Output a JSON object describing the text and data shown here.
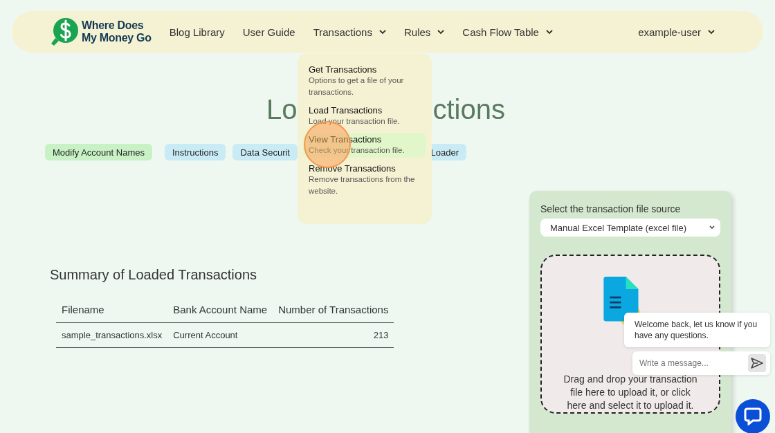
{
  "nav": {
    "logo": {
      "line1": "Where Does",
      "line2": "My Money Go"
    },
    "links": [
      {
        "label": "Blog Library",
        "has_caret": false
      },
      {
        "label": "User Guide",
        "has_caret": false
      },
      {
        "label": "Transactions",
        "has_caret": true
      },
      {
        "label": "Rules",
        "has_caret": true
      },
      {
        "label": "Cash Flow Table",
        "has_caret": true
      }
    ],
    "user": {
      "label": "example-user",
      "has_caret": true
    }
  },
  "menu": {
    "items": [
      {
        "title": "Get Transactions",
        "description": "Options to get a file of your transactions.",
        "selected": false
      },
      {
        "title": "Load Transactions",
        "description": "Load your transaction file.",
        "selected": false
      },
      {
        "title": "View Transactions",
        "description": "Check your transaction file.",
        "selected": true
      },
      {
        "title": "Remove Transactions",
        "description": "Remove transactions from the website.",
        "selected": false
      }
    ]
  },
  "page_title": {
    "left": "Lo",
    "right": "ctions"
  },
  "tabs": [
    {
      "label": "Modify Account Names",
      "color": "#c8f2c6"
    },
    {
      "label": "Instructions",
      "color": "#c9ebf5"
    },
    {
      "label": "Data Securit",
      "color": "#c9ebf5"
    },
    {
      "label": "Loader",
      "color": "#c9ebf5"
    }
  ],
  "summary": {
    "heading": "Summary of Loaded Transactions",
    "columns": [
      "Filename",
      "Bank Account Name",
      "Number of Transactions"
    ],
    "rows": [
      [
        "sample_transactions.xlsx",
        "Current Account",
        "213"
      ]
    ]
  },
  "upload": {
    "label": "Select the transaction file source",
    "source": "Manual Excel Template (excel file)",
    "drop_text": "Drag and drop your transaction file here to upload it, or click here and select it to upload it."
  },
  "chat": {
    "message": "Welcome back, let us know if you have any questions.",
    "placeholder": "Write a message..."
  }
}
